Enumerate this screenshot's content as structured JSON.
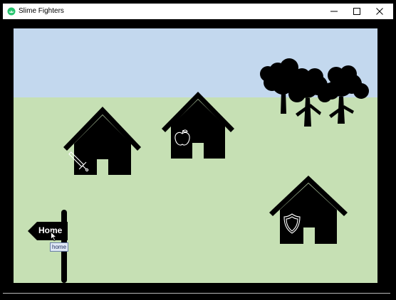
{
  "window": {
    "title": "Slime Fighters",
    "app_icon": "slime-icon",
    "controls": [
      "minimize-icon",
      "maximize-icon",
      "close-icon"
    ]
  },
  "scene": {
    "sky_color": "#c3d8ee",
    "grass_color": "#c6e0b4",
    "silhouette_color": "#000000",
    "buildings": [
      {
        "name": "weapon-shop",
        "icon": "sword-icon"
      },
      {
        "name": "food-shop",
        "icon": "apple-icon"
      },
      {
        "name": "armor-shop",
        "icon": "shield-icon"
      }
    ],
    "trees": 3,
    "signpost": {
      "label": "Home",
      "tooltip": "home"
    }
  }
}
